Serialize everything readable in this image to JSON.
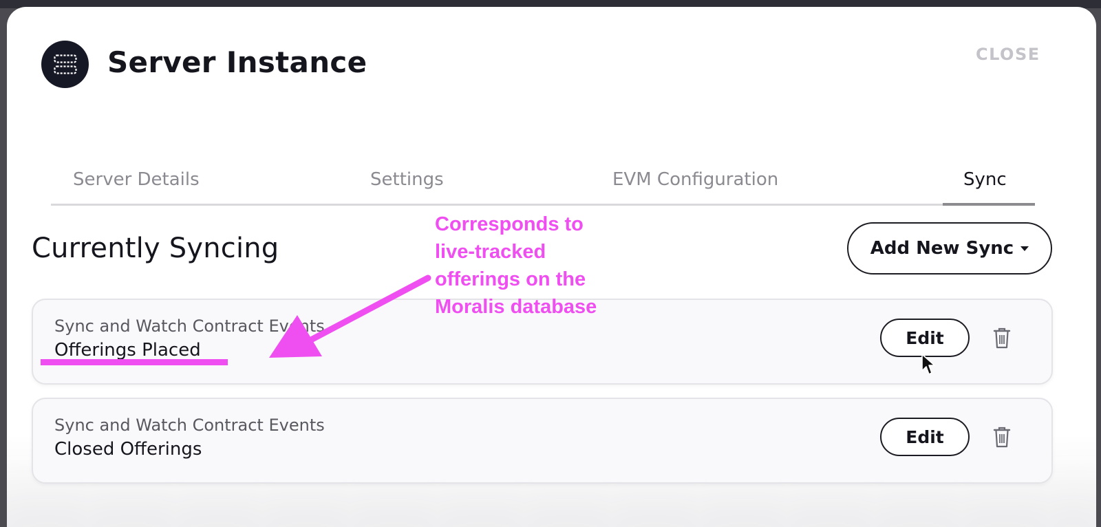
{
  "window": {
    "title": "Server Instance",
    "close_label": "CLOSE"
  },
  "tabs": [
    {
      "label": "Server Details",
      "active": false
    },
    {
      "label": "Settings",
      "active": false
    },
    {
      "label": "EVM Configuration",
      "active": false
    },
    {
      "label": "Sync",
      "active": true
    }
  ],
  "section": {
    "title": "Currently Syncing",
    "add_button_label": "Add New Sync"
  },
  "syncs": [
    {
      "type": "Sync and Watch Contract Events",
      "name": "Offerings Placed",
      "edit_label": "Edit"
    },
    {
      "type": "Sync and Watch Contract Events",
      "name": "Closed Offerings",
      "edit_label": "Edit"
    }
  ],
  "annotation": {
    "lines": [
      "Corresponds to",
      "live-tracked",
      "offerings on the",
      "Moralis database"
    ],
    "color": "#ef4ff0"
  },
  "colors": {
    "accent": "#ef4ff0",
    "text_primary": "#15151d",
    "text_muted": "#8a8a90",
    "icon_bg": "#161826"
  },
  "icons": {
    "header": "server-icon",
    "dropdown": "chevron-down-icon",
    "delete": "trash-icon",
    "pointer": "mouse-cursor-icon"
  }
}
